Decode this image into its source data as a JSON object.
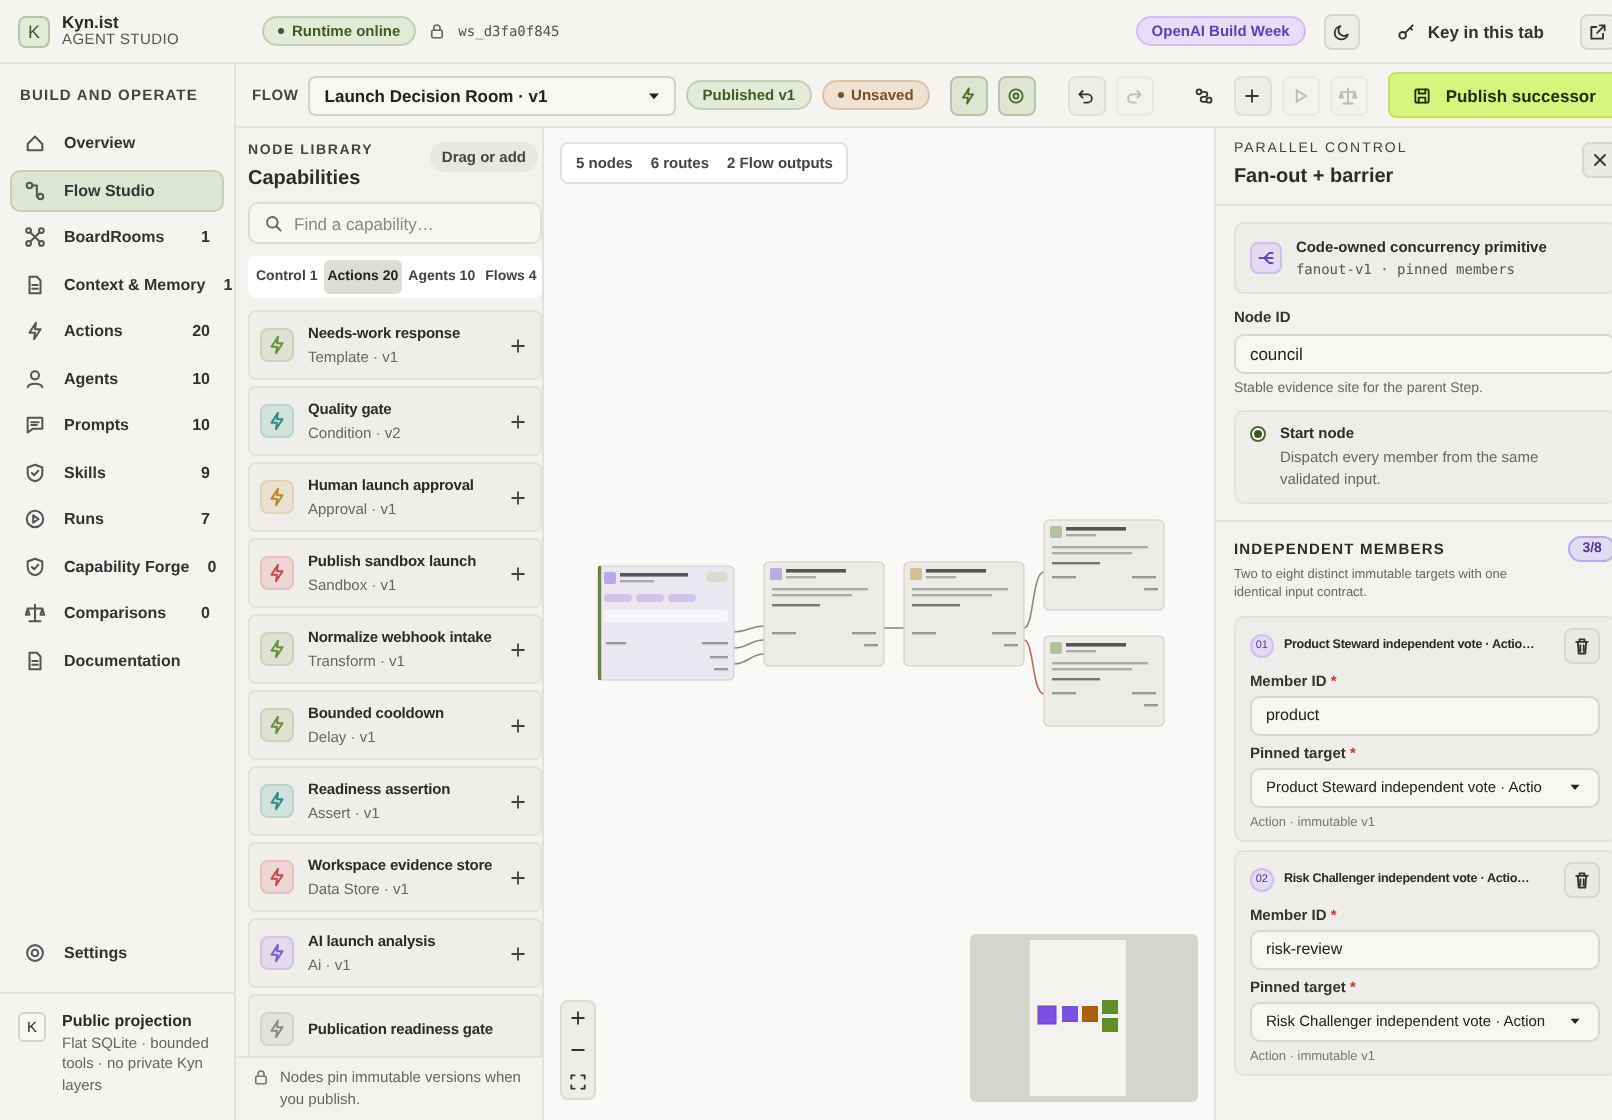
{
  "brand": {
    "logo": "K",
    "name": "Kyn.ist",
    "subtitle": "AGENT STUDIO"
  },
  "runtime_status": "Runtime online",
  "workspace_id": "ws_d3fa0f845",
  "event_badge": "OpenAI Build Week",
  "key_button": "Key in this tab",
  "sidebar": {
    "heading": "BUILD AND OPERATE",
    "items": [
      {
        "label": "Overview",
        "selected": false
      },
      {
        "label": "Flow Studio",
        "selected": true
      },
      {
        "label": "BoardRooms",
        "count": "1",
        "selected": false
      },
      {
        "label": "Context & Memory",
        "count": "1",
        "selected": false
      },
      {
        "label": "Actions",
        "count": "20",
        "selected": false
      },
      {
        "label": "Agents",
        "count": "10",
        "selected": false
      },
      {
        "label": "Prompts",
        "count": "10",
        "selected": false
      },
      {
        "label": "Skills",
        "count": "9",
        "selected": false
      },
      {
        "label": "Runs",
        "count": "7",
        "selected": false
      },
      {
        "label": "Capability Forge",
        "count": "0",
        "selected": false
      },
      {
        "label": "Comparisons",
        "count": "0",
        "selected": false
      },
      {
        "label": "Documentation",
        "selected": false
      }
    ],
    "settings": "Settings",
    "footer": {
      "logo": "K",
      "title": "Public projection",
      "description": "Flat SQLite · bounded tools · no private Kyn layers"
    }
  },
  "flow": {
    "label": "FLOW",
    "name": "Launch Decision Room · v1",
    "published": "Published v1",
    "unsaved": "Unsaved"
  },
  "toolbar": [
    {
      "kind": "button",
      "active": true,
      "disabled": false
    },
    {
      "kind": "button",
      "active": true,
      "disabled": false
    },
    {
      "kind": "button",
      "active": false,
      "disabled": false
    },
    {
      "kind": "button",
      "active": false,
      "disabled": true
    },
    {
      "kind": "plain",
      "active": false,
      "disabled": false
    },
    {
      "kind": "button",
      "active": false,
      "disabled": false
    },
    {
      "kind": "button",
      "active": false,
      "disabled": true
    },
    {
      "kind": "button",
      "active": false,
      "disabled": true
    }
  ],
  "publish_button": "Publish successor",
  "library": {
    "eyebrow": "NODE LIBRARY",
    "title": "Capabilities",
    "drag_hint": "Drag or add",
    "search": {
      "placeholder": "Find a capability…"
    },
    "tabs": [
      {
        "label": "Control",
        "count": "1",
        "selected": false
      },
      {
        "label": "Actions",
        "count": "20",
        "selected": true
      },
      {
        "label": "Agents",
        "count": "10",
        "selected": false
      },
      {
        "label": "Flows",
        "count": "4",
        "selected": false
      }
    ],
    "items": [
      {
        "title": "Needs-work response",
        "subtitle": "Template · v1",
        "color": "#6b8f3a"
      },
      {
        "title": "Quality gate",
        "subtitle": "Condition · v2",
        "color": "#2f8c86"
      },
      {
        "title": "Human launch approval",
        "subtitle": "Approval · v1",
        "color": "#b88a2e"
      },
      {
        "title": "Publish sandbox launch",
        "subtitle": "Sandbox · v1",
        "color": "#c94a4a"
      },
      {
        "title": "Normalize webhook intake",
        "subtitle": "Transform · v1",
        "color": "#6b8f3a"
      },
      {
        "title": "Bounded cooldown",
        "subtitle": "Delay · v1",
        "color": "#6b8f3a"
      },
      {
        "title": "Readiness assertion",
        "subtitle": "Assert · v1",
        "color": "#2f8c86"
      },
      {
        "title": "Workspace evidence store",
        "subtitle": "Data Store · v1",
        "color": "#c94a4a"
      },
      {
        "title": "AI launch analysis",
        "subtitle": "Ai · v1",
        "color": "#7b5ad6"
      },
      {
        "title": "Publication readiness gate",
        "color": "#8c8c84"
      }
    ],
    "note": "Nodes pin immutable versions when you publish."
  },
  "canvas": {
    "stats": [
      "5 nodes",
      "6 routes",
      "2 Flow outputs"
    ]
  },
  "inspector": {
    "eyebrow": "PARALLEL CONTROL",
    "title": "Fan-out + barrier",
    "primitive": {
      "title": "Code-owned concurrency primitive",
      "code": "fanout-v1 · pinned members"
    },
    "node_id": {
      "label": "Node ID",
      "value": "council",
      "hint": "Stable evidence site for the parent Step."
    },
    "start_node": {
      "label": "Start node",
      "description": "Dispatch every member from the same validated input.",
      "checked": true
    },
    "members": {
      "heading": "INDEPENDENT MEMBERS",
      "count": "3/8",
      "description": "Two to eight distinct immutable targets with one identical input contract.",
      "items": [
        {
          "index": "01",
          "title": "Product Steward independent vote · Actio…",
          "id_label": "Member ID",
          "id_required": "*",
          "member_id": "product",
          "target_label": "Pinned target",
          "target_required": "*",
          "target": "Product Steward independent vote · Actio",
          "meta": "Action · immutable v1"
        },
        {
          "index": "02",
          "title": "Risk Challenger independent vote · Actio…",
          "id_label": "Member ID",
          "id_required": "*",
          "member_id": "risk-review",
          "target_label": "Pinned target",
          "target_required": "*",
          "target": "Risk Challenger independent vote · Action",
          "meta": "Action · immutable v1"
        }
      ]
    }
  }
}
